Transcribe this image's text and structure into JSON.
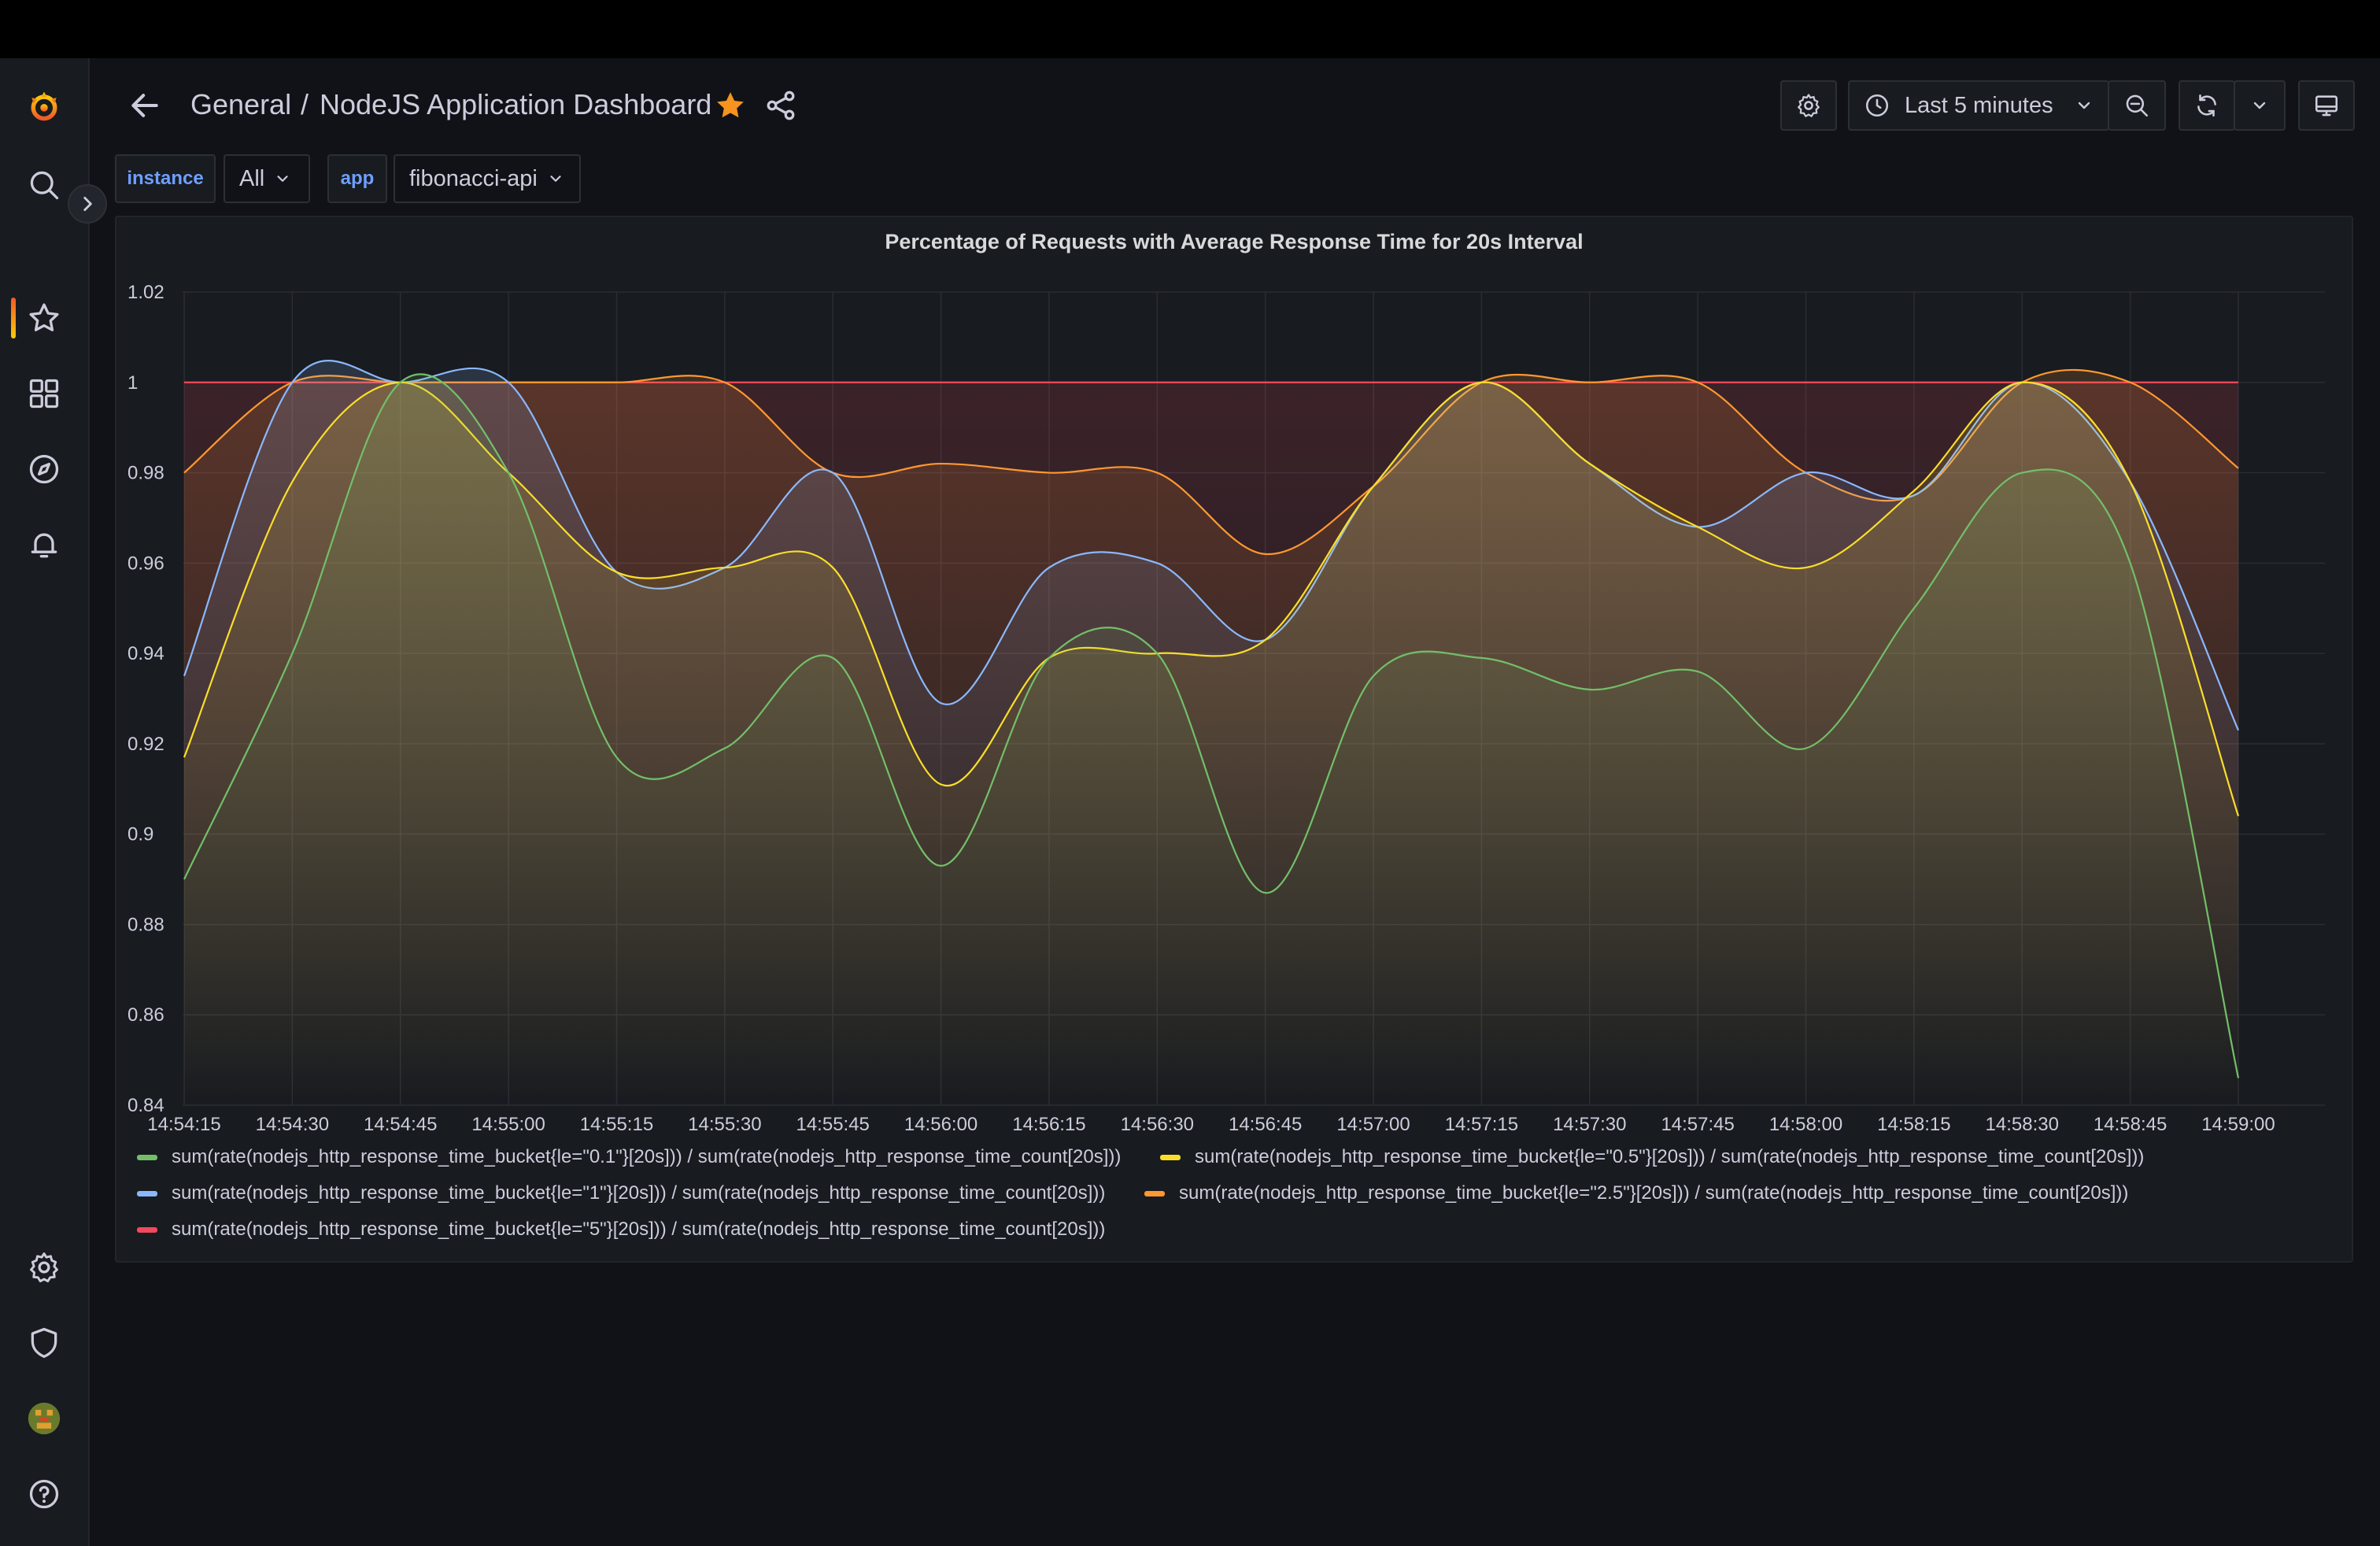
{
  "breadcrumb": {
    "folder": "General",
    "separator": "/",
    "dashboard": "NodeJS Application Dashboard"
  },
  "toolbar": {
    "time_range": "Last 5 minutes"
  },
  "variables": [
    {
      "label": "instance",
      "value": "All"
    },
    {
      "label": "app",
      "value": "fibonacci-api"
    }
  ],
  "icons": {
    "sidebar": [
      "grafana-logo-icon",
      "search-icon",
      "star-icon",
      "dashboards-icon",
      "explore-icon",
      "alerting-icon",
      "settings-icon",
      "shield-icon",
      "avatar",
      "help-icon"
    ],
    "header": [
      "back-arrow-icon",
      "star-icon",
      "share-icon",
      "gear-icon",
      "clock-icon",
      "chevron-down-icon",
      "zoom-out-icon",
      "refresh-icon",
      "tv-mode-icon"
    ]
  },
  "colors": {
    "accent_star": "#f7931e",
    "variable_label": "#6e9fff",
    "background": "#111217",
    "panel": "#181b1f"
  },
  "chart_data": {
    "type": "line",
    "title": "Percentage of Requests with Average Response Time for 20s Interval",
    "xlabel": "",
    "ylabel": "",
    "ylim": [
      0.84,
      1.02
    ],
    "yticks": [
      "1.02",
      "1",
      "0.98",
      "0.96",
      "0.94",
      "0.92",
      "0.9",
      "0.88",
      "0.86",
      "0.84"
    ],
    "ytick_values": [
      1.02,
      1.0,
      0.98,
      0.96,
      0.94,
      0.92,
      0.9,
      0.88,
      0.86,
      0.84
    ],
    "x_tick_labels": [
      "14:54:15",
      "14:54:30",
      "14:54:45",
      "14:55:00",
      "14:55:15",
      "14:55:30",
      "14:55:45",
      "14:56:00",
      "14:56:15",
      "14:56:30",
      "14:56:45",
      "14:57:00",
      "14:57:15",
      "14:57:30",
      "14:57:45",
      "14:58:00",
      "14:58:15",
      "14:58:30",
      "14:58:45",
      "14:59:00"
    ],
    "x": [
      "14:54:15",
      "14:54:30",
      "14:54:45",
      "14:55:00",
      "14:55:15",
      "14:55:30",
      "14:55:45",
      "14:56:00",
      "14:56:15",
      "14:56:30",
      "14:56:45",
      "14:57:00",
      "14:57:15",
      "14:57:30",
      "14:57:45",
      "14:58:00",
      "14:58:15",
      "14:58:30",
      "14:58:45",
      "14:59:00"
    ],
    "grid": true,
    "fill": true,
    "legend_position": "bottom",
    "series": [
      {
        "name": "sum(rate(nodejs_http_response_time_bucket{le=\"0.1\"}[20s])) / sum(rate(nodejs_http_response_time_count[20s]))",
        "color": "#73bf69",
        "values": [
          0.89,
          0.94,
          1.0,
          0.98,
          0.917,
          0.919,
          0.939,
          0.893,
          0.939,
          0.94,
          0.887,
          0.935,
          0.939,
          0.932,
          0.936,
          0.919,
          0.95,
          0.98,
          0.96,
          0.846
        ]
      },
      {
        "name": "sum(rate(nodejs_http_response_time_bucket{le=\"0.5\"}[20s])) / sum(rate(nodejs_http_response_time_count[20s]))",
        "color": "#fade2a",
        "values": [
          0.917,
          0.978,
          1.0,
          0.98,
          0.958,
          0.959,
          0.959,
          0.911,
          0.939,
          0.94,
          0.943,
          0.977,
          1.0,
          0.982,
          0.968,
          0.959,
          0.976,
          1.0,
          0.978,
          0.904
        ]
      },
      {
        "name": "sum(rate(nodejs_http_response_time_bucket{le=\"1\"}[20s])) / sum(rate(nodejs_http_response_time_count[20s]))",
        "color": "#8ab8ff",
        "values": [
          0.935,
          1.0,
          1.0,
          1.0,
          0.958,
          0.959,
          0.98,
          0.929,
          0.959,
          0.96,
          0.943,
          0.977,
          1.0,
          0.982,
          0.968,
          0.98,
          0.975,
          1.0,
          0.978,
          0.923
        ]
      },
      {
        "name": "sum(rate(nodejs_http_response_time_bucket{le=\"2.5\"}[20s])) / sum(rate(nodejs_http_response_time_count[20s]))",
        "color": "#ff9830",
        "values": [
          0.98,
          1.0,
          1.0,
          1.0,
          1.0,
          1.0,
          0.98,
          0.982,
          0.98,
          0.98,
          0.962,
          0.977,
          1.0,
          1.0,
          1.0,
          0.98,
          0.975,
          1.0,
          1.0,
          0.981
        ]
      },
      {
        "name": "sum(rate(nodejs_http_response_time_bucket{le=\"5\"}[20s])) / sum(rate(nodejs_http_response_time_count[20s]))",
        "color": "#f2495c",
        "values": [
          1.0,
          1.0,
          1.0,
          1.0,
          1.0,
          1.0,
          1.0,
          1.0,
          1.0,
          1.0,
          1.0,
          1.0,
          1.0,
          1.0,
          1.0,
          1.0,
          1.0,
          1.0,
          1.0,
          1.0
        ]
      }
    ]
  }
}
